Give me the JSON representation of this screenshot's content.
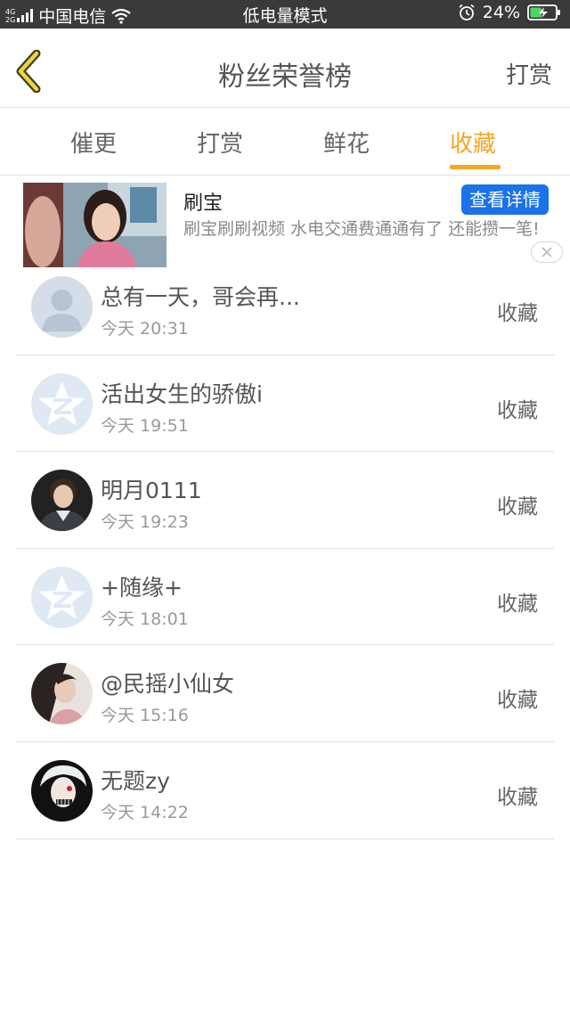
{
  "status_bar": {
    "network_type_top": "4G",
    "network_type_bottom": "2G",
    "carrier": "中国电信",
    "center_text": "低电量模式",
    "battery_percent": "24%",
    "battery_level": 0.24,
    "icons": [
      "signal-icon",
      "wifi-icon",
      "alarm-icon",
      "battery-icon"
    ]
  },
  "nav": {
    "title": "粉丝荣誉榜",
    "right_label": "打赏",
    "back_icon": "chevron-left-icon",
    "accent_color": "#f5a623"
  },
  "tabs": {
    "items": [
      {
        "label": "催更",
        "active": false
      },
      {
        "label": "打赏",
        "active": false
      },
      {
        "label": "鲜花",
        "active": false
      },
      {
        "label": "收藏",
        "active": true
      }
    ]
  },
  "ad": {
    "title": "刷宝",
    "button_label": "查看详情",
    "button_color": "#1a73e8",
    "description": "刷宝刷刷视频 水电交通费通通有了 还能攒一笔!"
  },
  "list": {
    "items": [
      {
        "name": "总有一天，哥会再...",
        "time": "今天 20:31",
        "action": "收藏",
        "avatar": "default-user-avatar"
      },
      {
        "name": "活出女生的骄傲i",
        "time": "今天 19:51",
        "action": "收藏",
        "avatar": "qzone-star-avatar"
      },
      {
        "name": "明月0111",
        "time": "今天 19:23",
        "action": "收藏",
        "avatar": "photo-avatar"
      },
      {
        "name": "+随缘+",
        "time": "今天 18:01",
        "action": "收藏",
        "avatar": "qzone-star-avatar"
      },
      {
        "name": "@民摇小仙女",
        "time": "今天 15:16",
        "action": "收藏",
        "avatar": "photo-avatar"
      },
      {
        "name": "无题zy",
        "time": "今天 14:22",
        "action": "收藏",
        "avatar": "photo-avatar"
      }
    ]
  }
}
